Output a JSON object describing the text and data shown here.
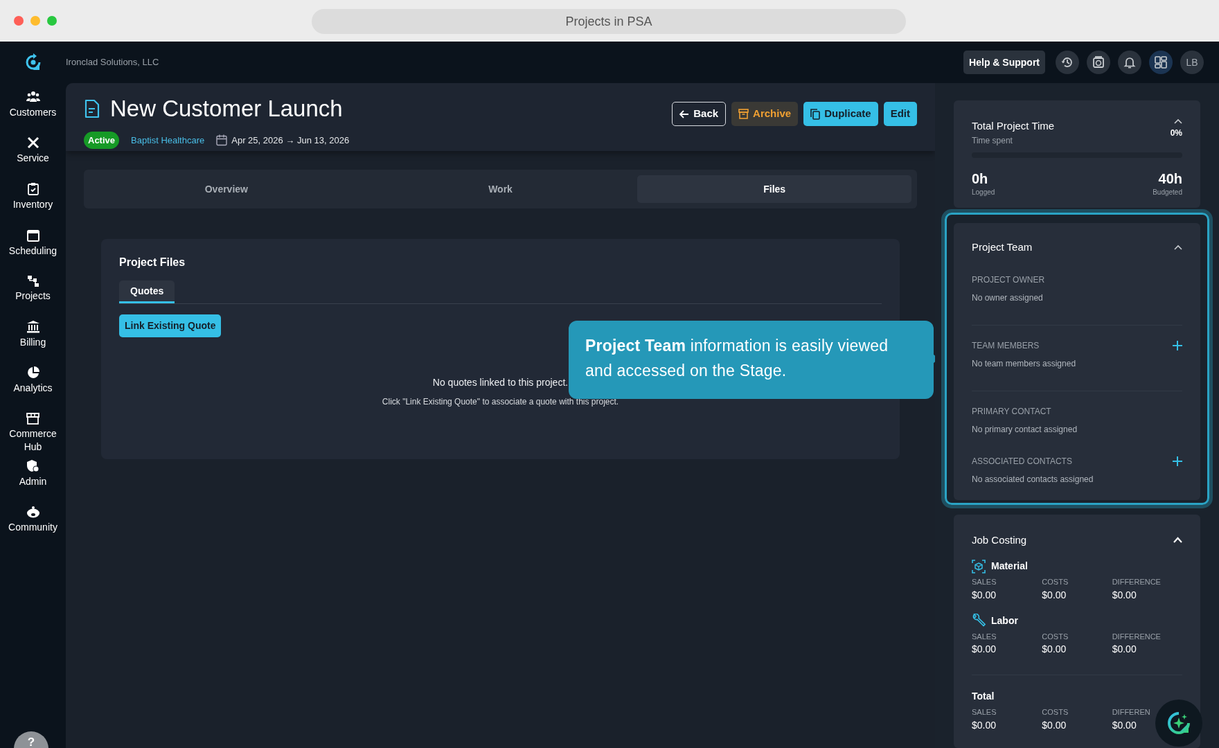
{
  "window": {
    "title": "Projects in PSA"
  },
  "topbar": {
    "company": "Ironclad Solutions, LLC",
    "help": "Help & Support",
    "icon_buttons": [
      {
        "selected": false
      },
      {
        "selected": false
      },
      {
        "selected": false
      },
      {
        "selected": true
      }
    ],
    "avatar": "LB"
  },
  "sidebar": {
    "items": [
      {
        "label": "Customers",
        "selected": false
      },
      {
        "label": "Service",
        "selected": false
      },
      {
        "label": "Inventory",
        "selected": false
      },
      {
        "label": "Scheduling",
        "selected": false
      },
      {
        "label": "Projects",
        "selected": false
      },
      {
        "label": "Billing",
        "selected": false
      },
      {
        "label": "Analytics",
        "selected": false
      },
      {
        "label": "Commerce Hub",
        "selected": false
      },
      {
        "label": "Admin",
        "selected": false
      },
      {
        "label": "Community",
        "selected": false
      }
    ],
    "help": "?"
  },
  "project": {
    "title": "New Customer Launch",
    "status": "Active",
    "customer": "Baptist Healthcare",
    "start": "Apr 25, 2026",
    "arrow": "→",
    "end": "Jun 13, 2026"
  },
  "actions": [
    {
      "kind": "outline",
      "label": "Back"
    },
    {
      "kind": "archive",
      "label": "Archive"
    },
    {
      "kind": "primary",
      "label": "Duplicate"
    },
    {
      "kind": "primary",
      "label": "Edit"
    }
  ],
  "tabs": [
    {
      "label": "Overview",
      "selected": false
    },
    {
      "label": "Work",
      "selected": false
    },
    {
      "label": "Files",
      "selected": true
    }
  ],
  "files": {
    "title": "Project Files",
    "subtabs": [
      {
        "label": "Quotes",
        "selected": true
      }
    ],
    "button": "Link Existing Quote",
    "empty": "No quotes linked to this project.",
    "hint": "Click \"Link Existing Quote\" to associate a quote with this project."
  },
  "tooltip": "**Project Team** information is easily viewed and accessed on the Stage.",
  "time": {
    "title": "Total Project Time",
    "subtitle": "Time spent",
    "percent": "0%",
    "level": 0,
    "logged": "0h",
    "logged_label": "Logged",
    "budgeted": "40h",
    "budgeted_label": "Budgeted"
  },
  "team": {
    "title": "Project Team",
    "sections": [
      {
        "label": "PROJECT OWNER",
        "value": "No owner assigned",
        "addable": false
      },
      {
        "label": "TEAM MEMBERS",
        "value": "No team members assigned",
        "addable": true
      },
      {
        "label": "PRIMARY CONTACT",
        "value": "No primary contact assigned",
        "addable": false
      },
      {
        "label": "ASSOCIATED CONTACTS",
        "value": "No associated contacts assigned",
        "addable": true
      }
    ]
  },
  "job_costing": {
    "title": "Job Costing",
    "groups": [
      {
        "kind": "material",
        "name": "Material",
        "cells": [
          {
            "label": "SALES",
            "value": "$0.00"
          },
          {
            "label": "COSTS",
            "value": "$0.00"
          },
          {
            "label": "DIFFERENCE",
            "value": "$0.00"
          }
        ]
      },
      {
        "kind": "labor",
        "name": "Labor",
        "cells": [
          {
            "label": "SALES",
            "value": "$0.00"
          },
          {
            "label": "COSTS",
            "value": "$0.00"
          },
          {
            "label": "DIFFERENCE",
            "value": "$0.00"
          }
        ]
      },
      {
        "kind": "total",
        "name": "Total",
        "cells": [
          {
            "label": "SALES",
            "value": "$0.00"
          },
          {
            "label": "COSTS",
            "value": "$0.00"
          },
          {
            "label": "DIFFEREN",
            "value": "$0.00"
          }
        ]
      }
    ]
  }
}
